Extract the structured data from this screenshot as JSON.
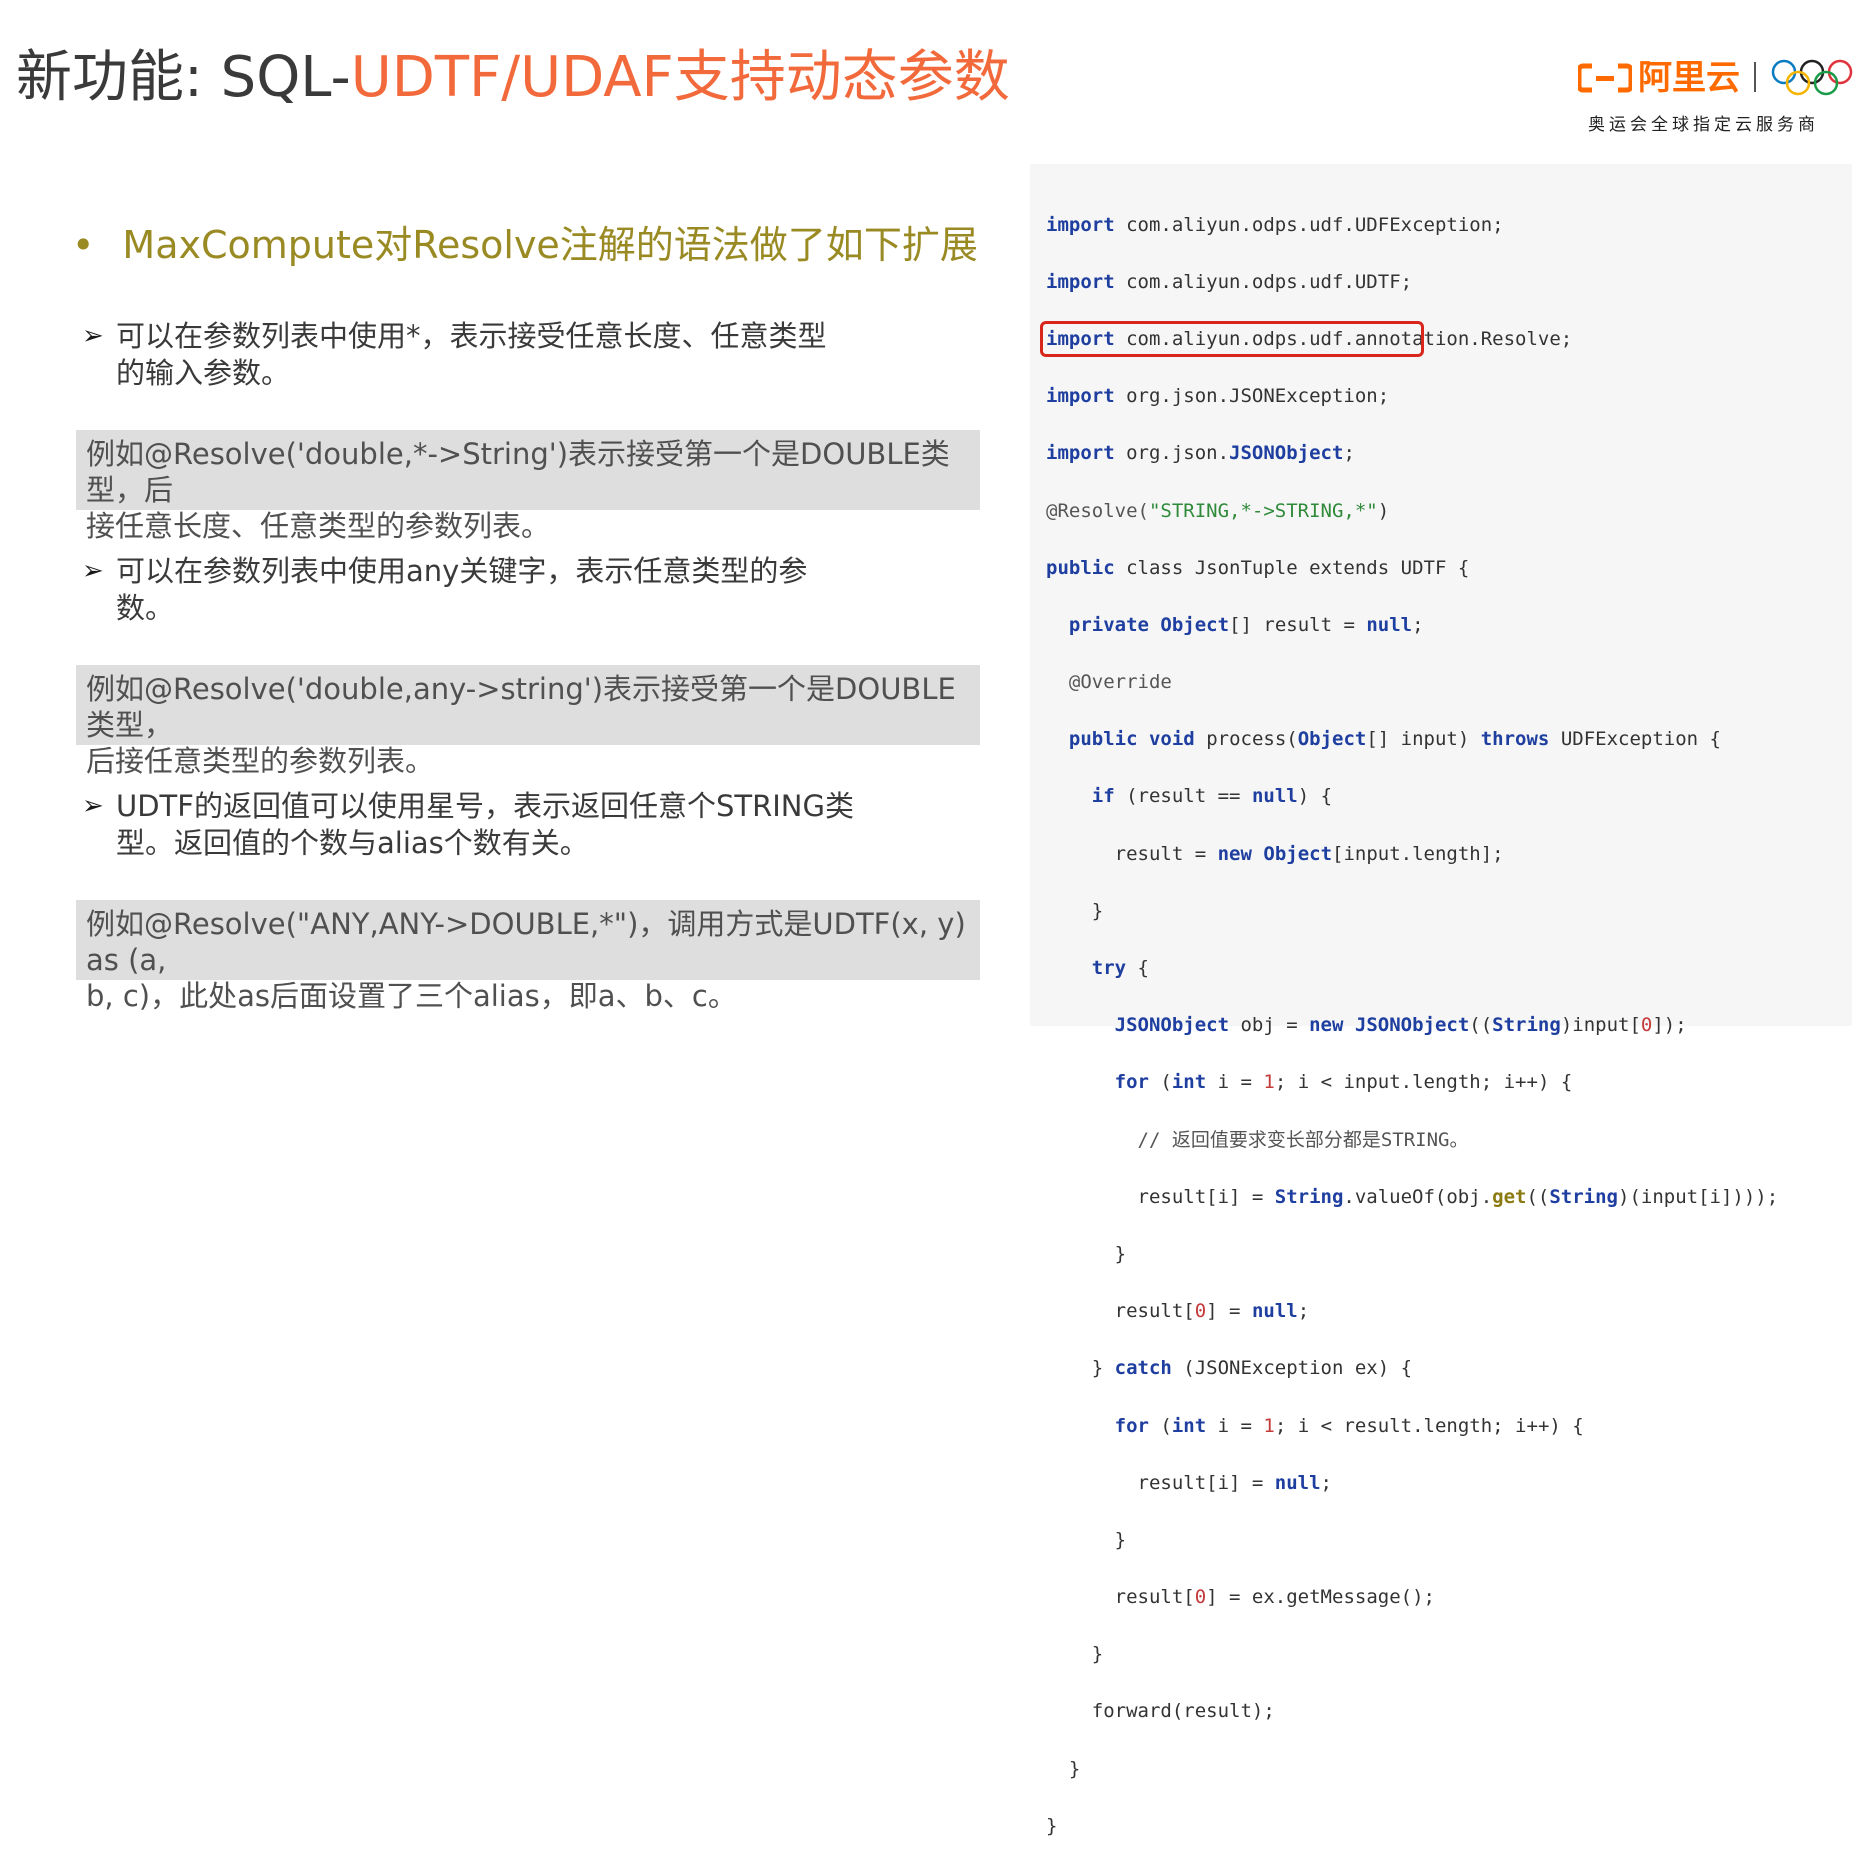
{
  "title": {
    "prefix": "新功能: SQL-",
    "highlight": "UDTF/UDAF支持动态参数"
  },
  "logo": {
    "brand": "阿里云",
    "subtitle": "奥运会全球指定云服务商",
    "brand_color": "#ff6a00"
  },
  "bullet": {
    "marker": "•",
    "text": "MaxCompute对Resolve注解的语法做了如下扩展"
  },
  "points": [
    {
      "marker": "➢",
      "lines": [
        "可以在参数列表中使用*，表示接受任意长度、任意类型",
        "的输入参数。"
      ],
      "example": [
        "例如@Resolve('double,*->String')表示接受第一个是DOUBLE类型，后",
        "接任意长度、任意类型的参数列表。"
      ]
    },
    {
      "marker": "➢",
      "lines": [
        "可以在参数列表中使用any关键字，表示任意类型的参",
        "数。"
      ],
      "example": [
        "例如@Resolve('double,any->string')表示接受第一个是DOUBLE类型，",
        "后接任意类型的参数列表。"
      ]
    },
    {
      "marker": "➢",
      "lines": [
        "UDTF的返回值可以使用星号，表示返回任意个STRING类",
        "型。返回值的个数与alias个数有关。"
      ],
      "example": [
        "例如@Resolve(\"ANY,ANY->DOUBLE,*\")，调用方式是UDTF(x, y) as (a,",
        "b, c)，此处as后面设置了三个alias，即a、b、c。"
      ]
    }
  ],
  "code": {
    "imports": [
      "com.aliyun.odps.udf.UDFException;",
      "com.aliyun.odps.udf.UDTF;",
      "com.aliyun.odps.udf.annotation.Resolve;",
      "org.json.JSONException;",
      "org.json."
    ],
    "import_kw": "import",
    "import_last_class": "JSONObject",
    "annotation": "@Resolve(",
    "annotation_arg": "\"STRING,*->STRING,*\"",
    "class_decl": "class JsonTuple extends UDTF {",
    "comment": "// 返回值要求变长部分都是STRING。"
  }
}
